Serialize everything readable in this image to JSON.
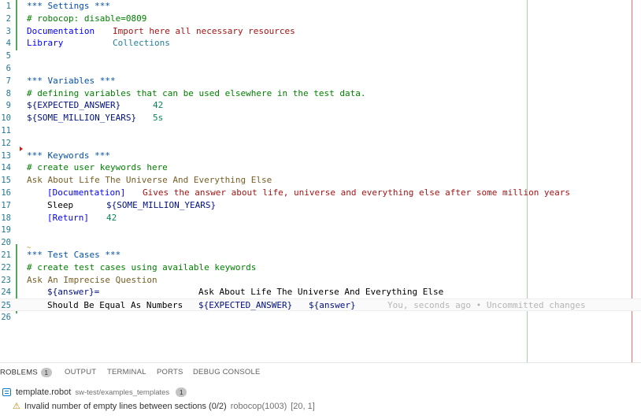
{
  "editor": {
    "lines": [
      {
        "n": "1",
        "segs": [
          [
            "c-header",
            "*** Settings ***",
            0
          ]
        ]
      },
      {
        "n": "2",
        "segs": [
          [
            "c-comment",
            "# robocop: disable=0809",
            0
          ]
        ]
      },
      {
        "n": "3",
        "segs": [
          [
            "c-setting",
            "Documentation",
            0
          ],
          [
            "c-value",
            "Import here all necessary resources",
            109
          ]
        ]
      },
      {
        "n": "4",
        "segs": [
          [
            "c-setting",
            "Library",
            0
          ],
          [
            "c-lib",
            "Collections",
            109
          ]
        ]
      },
      {
        "n": "5",
        "segs": []
      },
      {
        "n": "6",
        "segs": []
      },
      {
        "n": "7",
        "segs": [
          [
            "c-header",
            "*** Variables ***",
            0
          ]
        ]
      },
      {
        "n": "8",
        "segs": [
          [
            "c-comment",
            "# defining variables that can be used elsewhere in the test data.",
            0
          ]
        ]
      },
      {
        "n": "9",
        "segs": [
          [
            "c-var",
            "${EXPECTED_ANSWER}",
            0
          ],
          [
            "c-num",
            "42",
            160
          ]
        ]
      },
      {
        "n": "10",
        "segs": [
          [
            "c-var",
            "${SOME_MILLION_YEARS}",
            0
          ],
          [
            "c-num",
            "5s",
            160
          ]
        ]
      },
      {
        "n": "11",
        "segs": []
      },
      {
        "n": "12",
        "segs": []
      },
      {
        "n": "13",
        "segs": [
          [
            "c-header",
            "*** Keywords ***",
            0
          ]
        ]
      },
      {
        "n": "14",
        "segs": [
          [
            "c-comment",
            "# create user keywords here",
            0
          ]
        ]
      },
      {
        "n": "15",
        "segs": [
          [
            "c-kwdef",
            "Ask About Life The Universe And Everything Else",
            0
          ]
        ]
      },
      {
        "n": "16",
        "segs": [
          [
            "c-bracket",
            "[Documentation]",
            26
          ],
          [
            "c-value",
            "Gives the answer about life, universe and everything else after some million years",
            147
          ]
        ]
      },
      {
        "n": "17",
        "segs": [
          [
            "c-kw",
            "Sleep",
            26
          ],
          [
            "c-var",
            "${SOME_MILLION_YEARS}",
            101
          ]
        ]
      },
      {
        "n": "18",
        "segs": [
          [
            "c-bracket",
            "[Return]",
            26
          ],
          [
            "c-num",
            "42",
            101
          ]
        ]
      },
      {
        "n": "19",
        "segs": []
      },
      {
        "n": "20",
        "segs": []
      },
      {
        "n": "21",
        "segs": [
          [
            "c-header",
            "*** Test Cases ***",
            0
          ]
        ]
      },
      {
        "n": "22",
        "segs": [
          [
            "c-comment",
            "# create test cases using available keywords",
            0
          ]
        ]
      },
      {
        "n": "23",
        "segs": [
          [
            "c-kwdef",
            "Ask An Imprecise Question",
            0
          ]
        ]
      },
      {
        "n": "24",
        "segs": [
          [
            "c-var",
            "${answer}=",
            26
          ],
          [
            "c-kw",
            "Ask About Life The Universe And Everything Else",
            218
          ]
        ]
      },
      {
        "n": "25",
        "segs": [
          [
            "c-kw",
            "Should Be Equal As Numbers",
            26
          ],
          [
            "c-var",
            "${EXPECTED_ANSWER}",
            218
          ],
          [
            "c-var",
            "${answer}",
            358
          ],
          [
            "c-blame",
            "You, seconds ago • Uncommitted changes",
            458
          ]
        ]
      },
      {
        "n": "26",
        "segs": []
      }
    ],
    "current_line": "25",
    "squiggle": "~"
  },
  "panel": {
    "tabs": [
      {
        "label": "ROBLEMS",
        "badge": "1",
        "active": true
      },
      {
        "label": "OUTPUT"
      },
      {
        "label": "TERMINAL"
      },
      {
        "label": "PORTS"
      },
      {
        "label": "DEBUG CONSOLE"
      }
    ],
    "file": {
      "name": "template.robot",
      "path": "sw-test/examples_templates",
      "count": "1"
    },
    "problem": {
      "message": "Invalid number of empty lines between sections (0/2)",
      "source": "robocop(1003)",
      "location": "[20, 1]"
    }
  },
  "colors": {
    "ruler_green": "#a5d6a7",
    "ruler_red": "#e57373",
    "gutter_added": "#58a55c"
  }
}
